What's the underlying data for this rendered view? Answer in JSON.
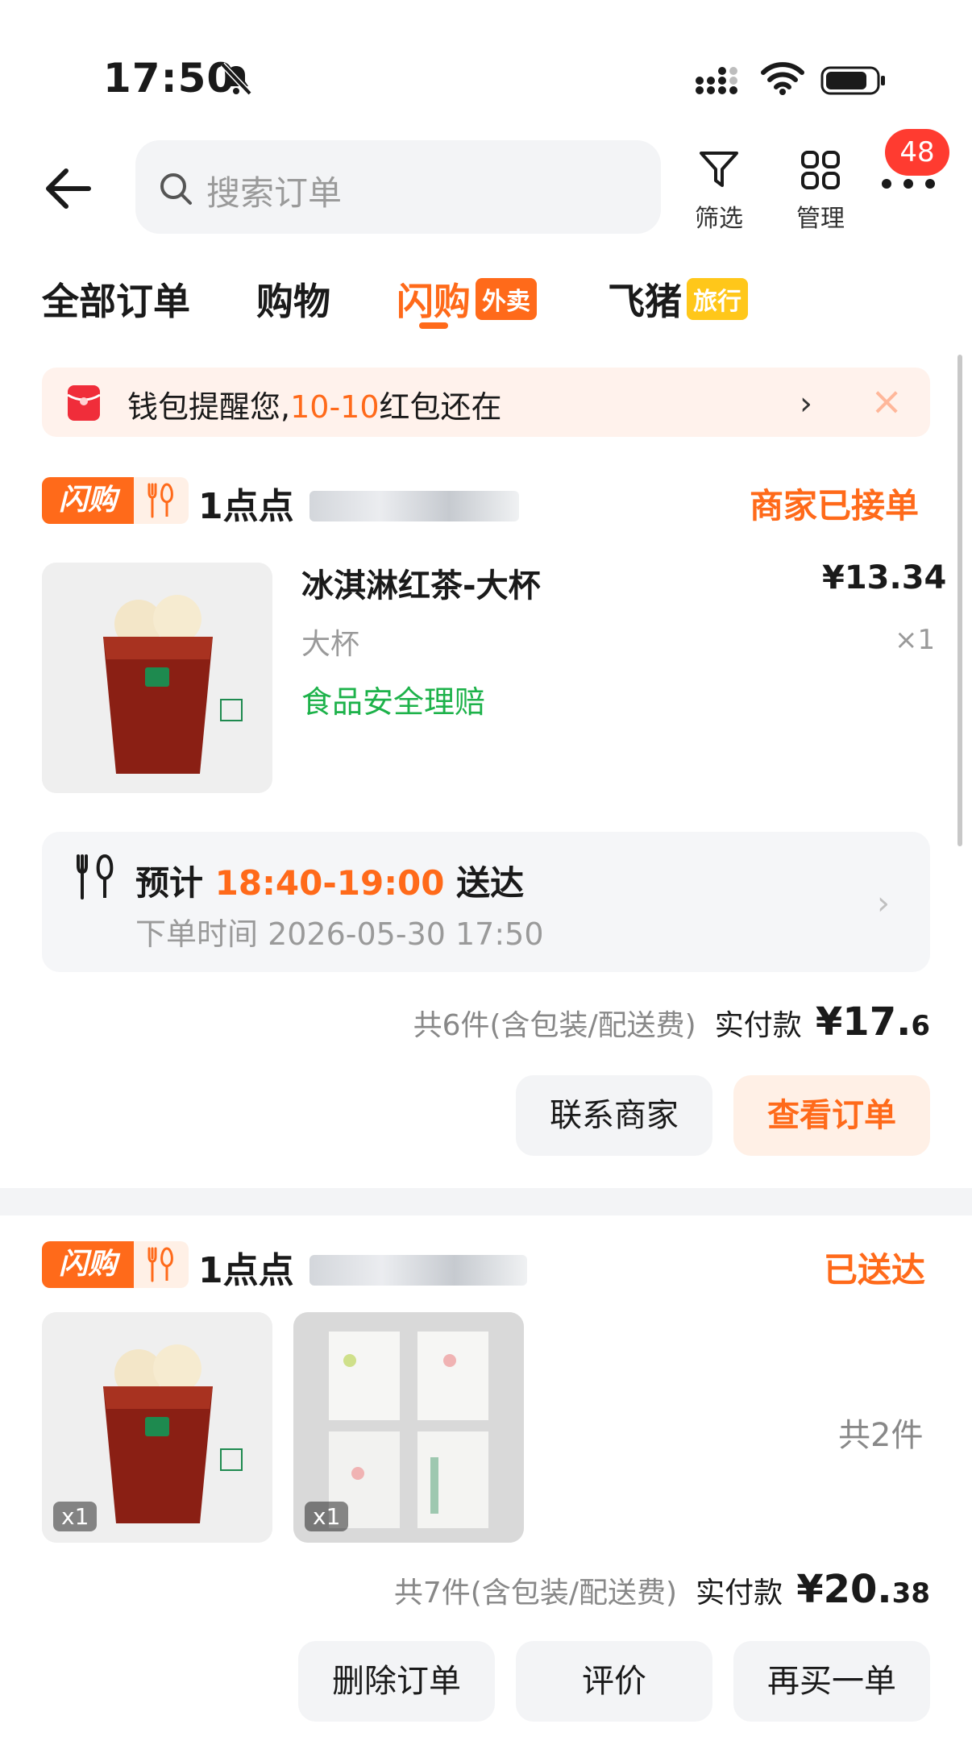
{
  "status_bar": {
    "time": "17:50"
  },
  "header": {
    "search_placeholder": "搜索订单",
    "filter_label": "筛选",
    "manage_label": "管理",
    "badge_count": "48"
  },
  "tabs": [
    {
      "label": "全部订单",
      "tag": ""
    },
    {
      "label": "购物",
      "tag": ""
    },
    {
      "label": "闪购",
      "tag": "外卖"
    },
    {
      "label": "飞猪",
      "tag": "旅行"
    }
  ],
  "banner": {
    "prefix": "钱包提醒您,",
    "highlight": "10-10",
    "suffix": "红包还在"
  },
  "orders": [
    {
      "badge": "闪购",
      "store": "1点点",
      "status": "商家已接单",
      "item": {
        "name": "冰淇淋红茶-大杯",
        "price": "¥13.34",
        "spec": "大杯",
        "qty": "×1",
        "safety": "食品安全理赔"
      },
      "eta": {
        "prefix": "预计",
        "window": "18:40-19:00",
        "suffix": "送达",
        "order_time": "下单时间 2026-05-30 17:50"
      },
      "summary": "共6件(含包装/配送费)",
      "paid_label": "实付款",
      "paid_main": "¥17.",
      "paid_decimal": "6",
      "buttons": [
        "联系商家",
        "查看订单"
      ]
    },
    {
      "badge": "闪购",
      "store": "1点点",
      "status": "已送达",
      "thumb_qty": [
        "x1",
        "x1"
      ],
      "count": "共2件",
      "summary": "共7件(含包装/配送费)",
      "paid_label": "实付款",
      "paid_main": "¥20.",
      "paid_decimal": "38",
      "buttons": [
        "删除订单",
        "评价",
        "再买一单"
      ]
    }
  ],
  "colors": {
    "accent": "#ff6a1a",
    "safety_green": "#1db24a",
    "badge_red": "#ff3b30"
  }
}
